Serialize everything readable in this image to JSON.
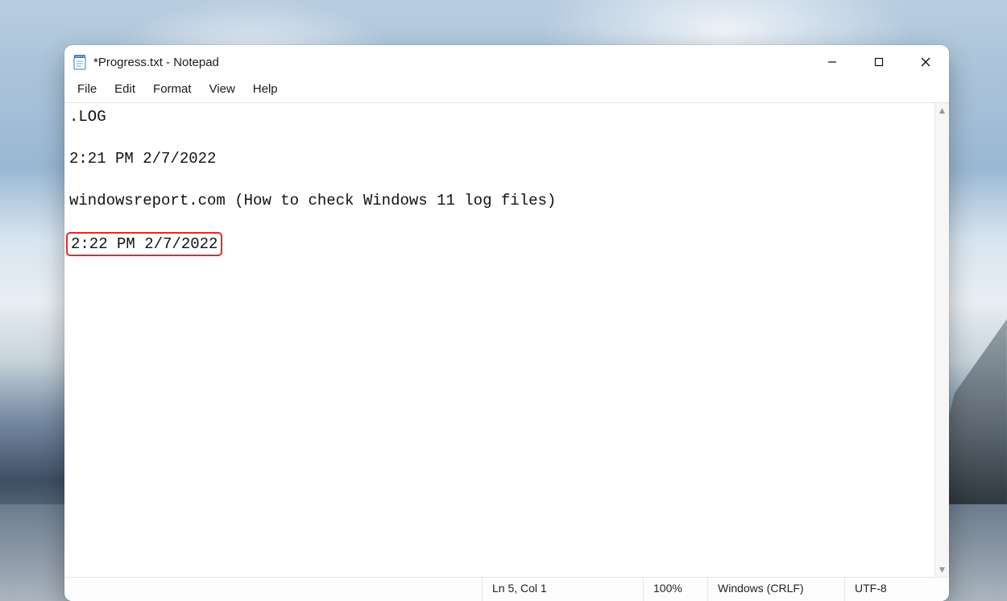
{
  "window": {
    "title": "*Progress.txt - Notepad"
  },
  "menu": {
    "file": "File",
    "edit": "Edit",
    "format": "Format",
    "view": "View",
    "help": "Help"
  },
  "content": {
    "lines": [
      ".LOG",
      "2:21 PM 2/7/2022",
      "windowsreport.com (How to check Windows 11 log files)",
      "2:22 PM 2/7/2022"
    ],
    "highlight_index": 3
  },
  "status": {
    "position": "Ln 5, Col 1",
    "zoom": "100%",
    "line_ending": "Windows (CRLF)",
    "encoding": "UTF-8"
  },
  "icons": {
    "notepad": "notepad-icon",
    "minimize": "minimize-icon",
    "maximize": "maximize-icon",
    "close": "close-icon",
    "scroll_up": "scroll-up-icon",
    "scroll_down": "scroll-down-icon"
  }
}
